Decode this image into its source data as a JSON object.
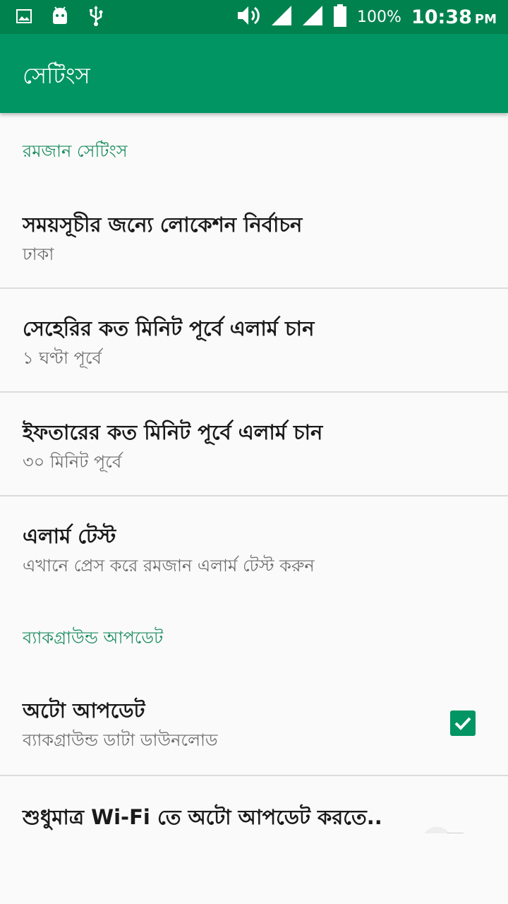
{
  "status_bar": {
    "left_icons": [
      "image-icon",
      "android-icon",
      "usb-icon"
    ],
    "right_icons": [
      "volume-icon",
      "signal-icon",
      "signal-icon",
      "battery-icon"
    ],
    "battery_percent": "100%",
    "time": "10:38",
    "ampm": "PM"
  },
  "app_bar": {
    "title": "সেটিংস"
  },
  "sections": {
    "ramadan": {
      "header": "রমজান সেটিংস"
    },
    "background": {
      "header": "ব্যাকগ্রাউন্ড আপডেট"
    }
  },
  "prefs": {
    "location": {
      "title": "সময়সূচীর জন্যে লোকেশন নির্বাচন",
      "summary": "ঢাকা"
    },
    "sehri_alarm": {
      "title": "সেহেরির কত মিনিট পূর্বে এলার্ম চান",
      "summary": "১ ঘণ্টা পূর্বে"
    },
    "iftar_alarm": {
      "title": "ইফতারের কত মিনিট পূর্বে এলার্ম চান",
      "summary": "৩০ মিনিট পূর্বে"
    },
    "alarm_test": {
      "title": "এলার্ম টেস্ট",
      "summary": "এখানে প্রেস করে রমজান এলার্ম টেস্ট করুন"
    },
    "auto_update": {
      "title": "অটো আপডেট",
      "summary": "ব্যাকগ্রাউন্ড ডাটা ডাউনলোড",
      "checked": true
    },
    "wifi_only": {
      "title": "শুধুমাত্র Wi-Fi তে অটো আপডেট করতে..",
      "enabled": false
    }
  },
  "colors": {
    "status_bar": "#00824f",
    "app_bar": "#009562",
    "accent": "#009562",
    "section_header": "#1b8c5f"
  }
}
